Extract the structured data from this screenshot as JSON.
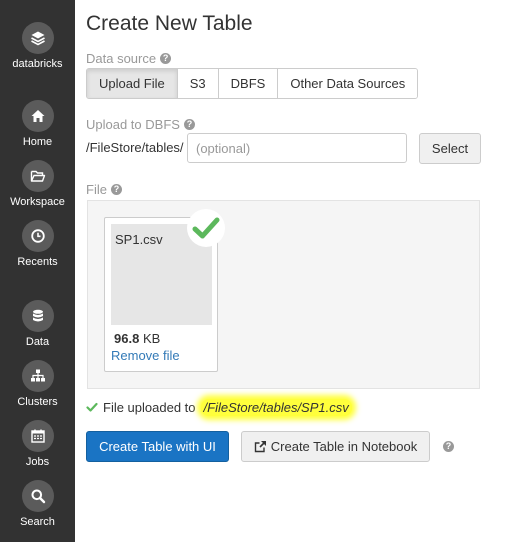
{
  "sidebar": {
    "brand": "databricks",
    "items": [
      {
        "label": "Home",
        "icon": "home-icon"
      },
      {
        "label": "Workspace",
        "icon": "folder-open-icon"
      },
      {
        "label": "Recents",
        "icon": "clock-icon"
      },
      {
        "label": "Data",
        "icon": "database-icon"
      },
      {
        "label": "Clusters",
        "icon": "sitemap-icon"
      },
      {
        "label": "Jobs",
        "icon": "calendar-icon"
      },
      {
        "label": "Search",
        "icon": "search-icon"
      }
    ]
  },
  "page": {
    "title": "Create New Table"
  },
  "data_source": {
    "label": "Data source",
    "tabs": [
      "Upload File",
      "S3",
      "DBFS",
      "Other Data Sources"
    ],
    "active_tab": "Upload File"
  },
  "upload_dbfs": {
    "label": "Upload to DBFS",
    "prefix": "/FileStore/tables/",
    "placeholder": "(optional)",
    "value": "",
    "select_label": "Select"
  },
  "file": {
    "label": "File",
    "name": "SP1.csv",
    "size_value": "96.8",
    "size_unit": "KB",
    "remove_label": "Remove file"
  },
  "status": {
    "text": "File uploaded to",
    "path": "/FileStore/tables/SP1.csv"
  },
  "actions": {
    "create_ui_label": "Create Table with UI",
    "create_notebook_label": "Create Table in Notebook"
  },
  "colors": {
    "sidebar_bg": "#323232",
    "primary": "#1a74c4",
    "success": "#5cb85c",
    "highlight": "#ffff3c",
    "link": "#337ab7"
  }
}
